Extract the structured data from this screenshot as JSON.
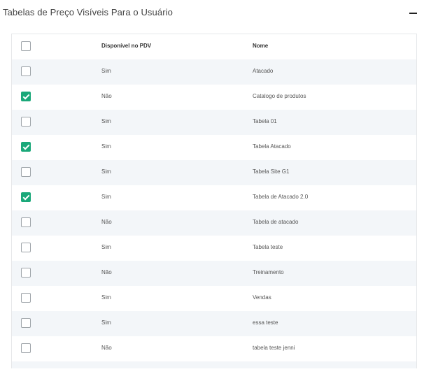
{
  "section": {
    "title": "Tabelas de Preço Visíveis Para o Usuário"
  },
  "table": {
    "headers": {
      "pdv": "Disponível no PDV",
      "name": "Nome"
    },
    "rows": [
      {
        "pdv": "Sim",
        "name": "Atacado",
        "checked": false
      },
      {
        "pdv": "Não",
        "name": "Catalogo de produtos",
        "checked": true
      },
      {
        "pdv": "Sim",
        "name": "Tabela 01",
        "checked": false
      },
      {
        "pdv": "Sim",
        "name": "Tabela Atacado",
        "checked": true
      },
      {
        "pdv": "Sim",
        "name": "Tabela Site G1",
        "checked": false
      },
      {
        "pdv": "Sim",
        "name": "Tabela de Atacado 2.0",
        "checked": true
      },
      {
        "pdv": "Não",
        "name": "Tabela de atacado",
        "checked": false
      },
      {
        "pdv": "Sim",
        "name": "Tabela teste",
        "checked": false
      },
      {
        "pdv": "Não",
        "name": "Treinamento",
        "checked": false
      },
      {
        "pdv": "Sim",
        "name": "Vendas",
        "checked": false
      },
      {
        "pdv": "Sim",
        "name": "essa teste",
        "checked": false
      },
      {
        "pdv": "Não",
        "name": "tabela teste jenni",
        "checked": false
      }
    ]
  },
  "colors": {
    "accent": "#1aa879",
    "row_alt": "#f3f6f9"
  }
}
